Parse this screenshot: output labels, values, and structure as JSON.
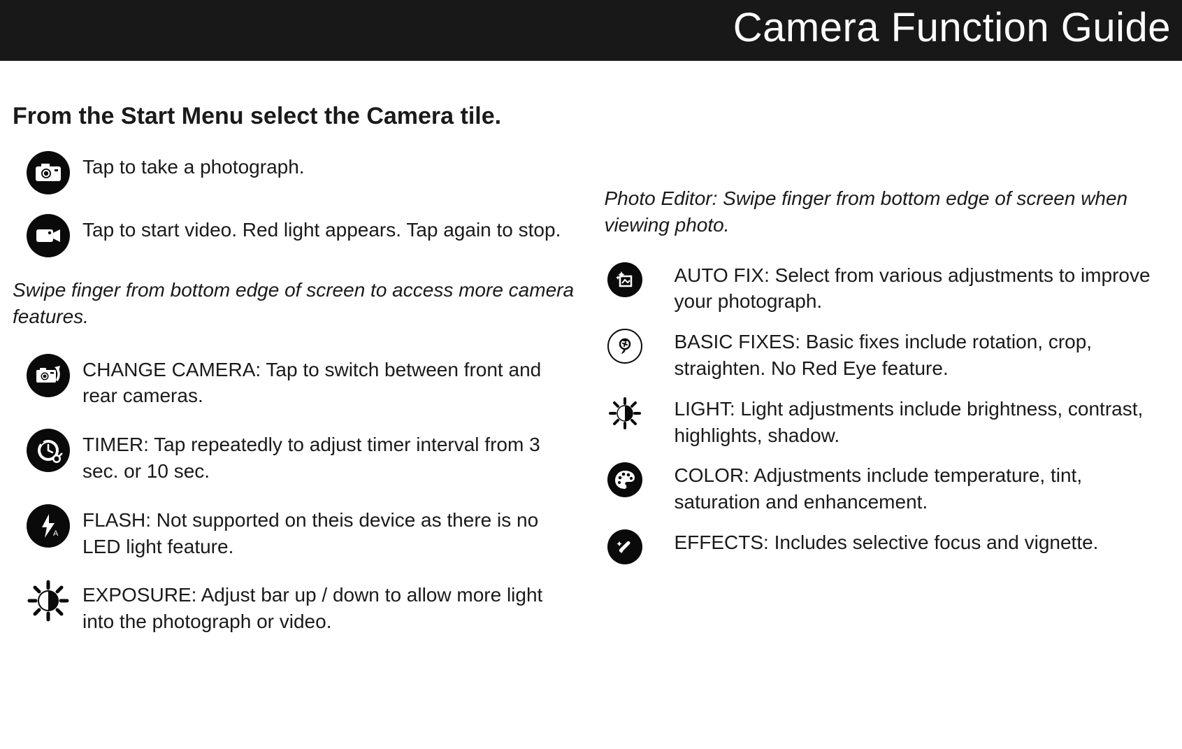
{
  "header": {
    "title": "Camera Function Guide"
  },
  "left": {
    "title": "From the Start Menu select the Camera tile.",
    "hint": "Swipe finger from bottom edge of screen to access more camera features.",
    "primary": [
      {
        "text": "Tap to take a photograph.",
        "icon": "camera-icon"
      },
      {
        "text": "Tap to start video. Red light appears. Tap again to stop.",
        "icon": "video-icon"
      }
    ],
    "features": [
      {
        "text": "CHANGE CAMERA: Tap to switch between front and rear cameras.",
        "icon": "switch-camera-icon"
      },
      {
        "text": "TIMER: Tap repeatedly to adjust timer interval  from 3 sec. or 10 sec.",
        "icon": "timer-icon"
      },
      {
        "text": "FLASH: Not supported on theis device as there is no LED light feature.",
        "icon": "flash-icon"
      },
      {
        "text": "EXPOSURE: Adjust bar up / down to allow more light into the photograph or video.",
        "icon": "exposure-icon"
      }
    ]
  },
  "right": {
    "hint": "Photo Editor: Swipe finger from bottom edge of screen when viewing photo.",
    "editor": [
      {
        "text": "AUTO FIX: Select from various adjustments to  improve your photograph.",
        "icon": "autofix-icon"
      },
      {
        "text": "BASIC FIXES: Basic fixes include rotation, crop, straighten. No Red Eye feature.",
        "icon": "basicfix-icon"
      },
      {
        "text": "LIGHT: Light adjustments include brightness, contrast, highlights, shadow.",
        "icon": "light-icon"
      },
      {
        "text": "COLOR: Adjustments include temperature, tint, saturation and enhancement.",
        "icon": "color-icon"
      },
      {
        "text": "EFFECTS: Includes selective focus and vignette.",
        "icon": "effects-icon"
      }
    ]
  }
}
